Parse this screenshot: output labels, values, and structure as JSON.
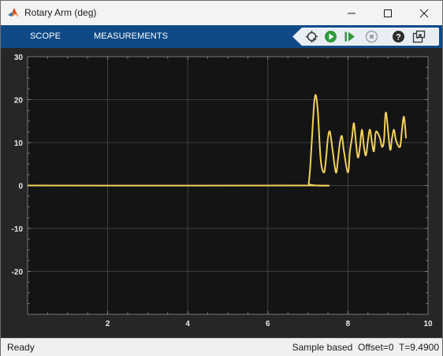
{
  "window": {
    "title": "Rotary Arm (deg)"
  },
  "toolstrip": {
    "tabs": [
      "SCOPE",
      "MEASUREMENTS"
    ],
    "icons": [
      "highlight-signal-icon",
      "run-icon",
      "step-forward-icon",
      "stop-icon",
      "help-icon",
      "undock-icon"
    ]
  },
  "statusbar": {
    "left": "Ready",
    "sample_mode": "Sample based",
    "offset": "Offset=0",
    "time": "T=9.4900"
  },
  "colors": {
    "signal": "#f2d15c",
    "axes_bg": "#141414",
    "toolstrip": "#0f4a86"
  },
  "chart_data": {
    "type": "line",
    "title": "",
    "xlabel": "",
    "ylabel": "",
    "xlim": [
      0,
      10
    ],
    "ylim": [
      -30,
      30
    ],
    "xticks": [
      2,
      4,
      6,
      8,
      10
    ],
    "yticks": [
      30,
      20,
      10,
      0,
      -10,
      -20
    ],
    "grid": true,
    "series": [
      {
        "x": [
          0,
          7.0,
          7.02,
          7.06,
          7.12,
          7.16,
          7.2,
          7.25,
          7.32,
          7.4,
          7.45,
          7.5,
          7.55,
          7.62,
          7.7,
          7.75,
          7.8,
          7.85,
          7.9,
          8.0,
          8.05,
          8.1,
          8.15,
          8.2,
          8.25,
          8.3,
          8.35,
          8.4,
          8.45,
          8.5,
          8.55,
          8.6,
          8.65,
          8.7,
          8.8,
          8.85,
          8.9,
          8.95,
          9.05,
          9.1,
          9.15,
          9.2,
          9.3,
          9.35,
          9.4,
          9.45
        ],
        "y": [
          0,
          0,
          0.4,
          4.5,
          14,
          19.5,
          21,
          17,
          6,
          3,
          6,
          11,
          12.5,
          8,
          3,
          6,
          10,
          11.5,
          8,
          3,
          8,
          11,
          14.5,
          10,
          6.5,
          9,
          13,
          9,
          7,
          10.5,
          13,
          10,
          8,
          12.5,
          11,
          9,
          10.5,
          17,
          8.5,
          11,
          13,
          10.5,
          9,
          13,
          16,
          11
        ]
      }
    ]
  }
}
